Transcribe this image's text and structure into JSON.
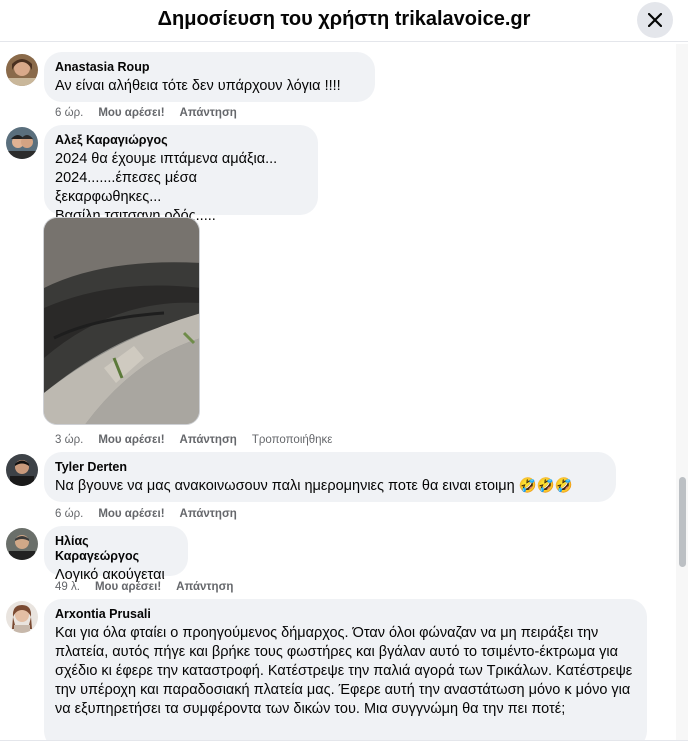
{
  "header": {
    "title": "Δημοσίευση του χρήστη trikalavoice.gr"
  },
  "comments": [
    {
      "author": "Anastasia Roup",
      "text": "Αν είναι αλήθεια τότε δεν υπάρχουν λόγια !!!!",
      "time": "6 ώρ.",
      "like": "Μου αρέσει!",
      "reply": "Απάντηση"
    },
    {
      "author": "Αλεξ Καραγιώργος",
      "text": "2024 θα έχουμε ιπτάμενα αμάξια...\n2024.......έπεσες μέσα ξεκαρφωθηκες...\nΒασίλη τσιτσανη οδός.....",
      "time": "3 ώρ.",
      "like": "Μου αρέσει!",
      "reply": "Απάντηση",
      "edited": "Τροποποιήθηκε"
    },
    {
      "author": "Tyler Derten",
      "text": "Να βγουνε να μας ανακοινωσουν παλι ημερομηνιες ποτε θα ειναι ετοιμη 🤣🤣🤣",
      "time": "6 ώρ.",
      "like": "Μου αρέσει!",
      "reply": "Απάντηση"
    },
    {
      "author": "Ηλίας Καραγεώργος",
      "text": "Λογικό ακούγεται",
      "time": "49 λ.",
      "like": "Μου αρέσει!",
      "reply": "Απάντηση"
    },
    {
      "author": "Arxontia Prusali",
      "text": "Και για όλα φταίει ο προηγούμενος δήμαρχος. Όταν όλοι φώναζαν να μη πειράξει την πλατεία, αυτός πήγε και βρήκε τους φωστήρες και βγάλαν αυτό το τσιμέντο-έκτρωμα για σχέδιο κι έφερε την καταστροφή. Κατέστρεψε την παλιά αγορά των Τρικάλων. Κατέστρεψε την υπέροχη και παραδοσιακή πλατεία μας. Έφερε αυτή την αναστάτωση μόνο κ μόνο για να εξυπηρετήσει τα συμφέροντα των δικών του. Μια συγγνώμη θα την πει ποτέ;"
    }
  ],
  "colors": {
    "bubble": "#f0f2f5",
    "secondary_text": "#65676b",
    "close_button": "#e4e6eb"
  }
}
